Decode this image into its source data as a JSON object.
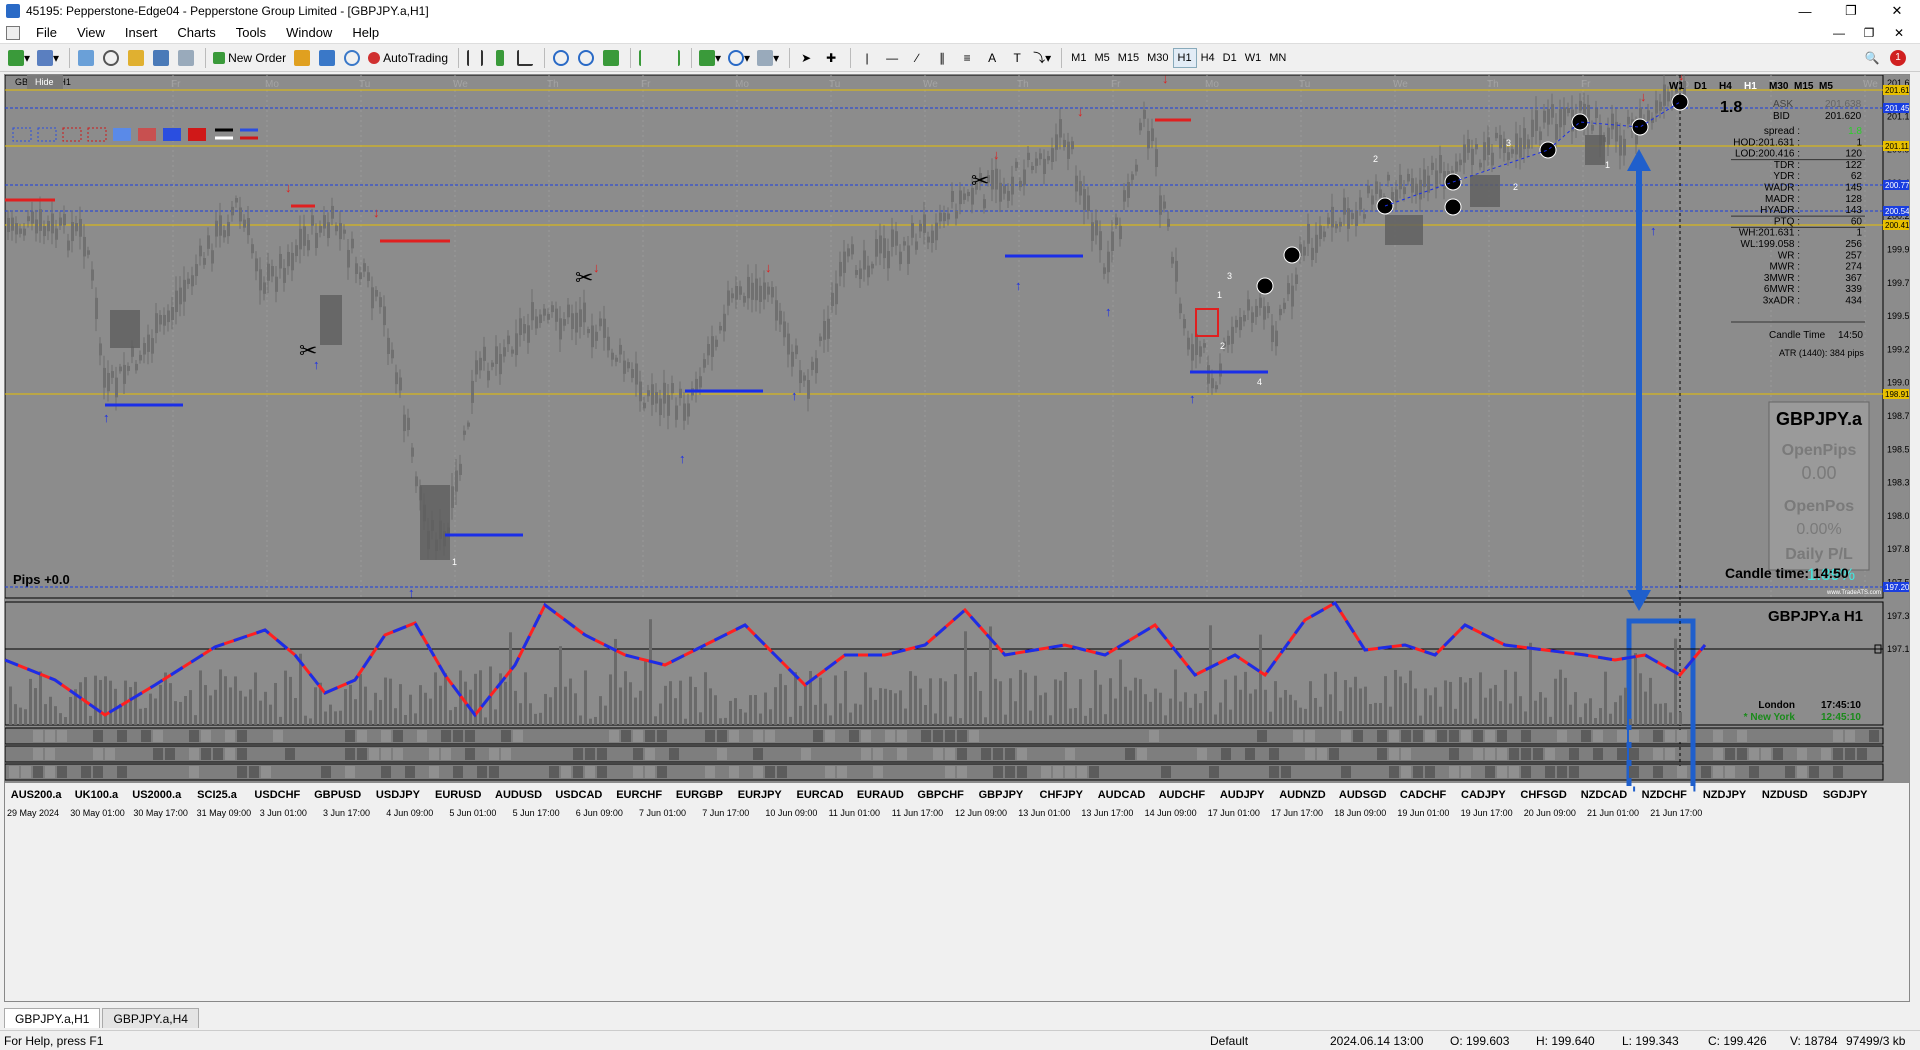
{
  "window": {
    "title": "45195: Pepperstone-Edge04 - Pepperstone Group Limited - [GBPJPY.a,H1]"
  },
  "menu": [
    "File",
    "View",
    "Insert",
    "Charts",
    "Tools",
    "Window",
    "Help"
  ],
  "toolbar": {
    "new_order": "New Order",
    "autotrading": "AutoTrading",
    "timeframes": [
      "M1",
      "M5",
      "M15",
      "M30",
      "H1",
      "H4",
      "D1",
      "W1",
      "MN"
    ],
    "active_timeframe": "H1"
  },
  "chart": {
    "symbol_label": "GBPJPY.a,H1",
    "hide_label": "Hide",
    "day_labels": [
      "Fr",
      "Mo",
      "Tu",
      "We",
      "Th",
      "Fr",
      "Mo",
      "Tu",
      "We",
      "Th",
      "Fr",
      "Mo",
      "Tu",
      "We",
      "Th",
      "Fr",
      "Mo",
      "Tu",
      "We",
      "Th",
      "Fr"
    ],
    "tf_panel": [
      "W1",
      "D1",
      "H4",
      "H1",
      "M30",
      "M15",
      "M5"
    ],
    "active_tf": "H1",
    "price_scale": [
      "201.638",
      "201.180",
      "200.944",
      "200.485",
      "200.222",
      "199.980",
      "199.745",
      "199.505",
      "199.265",
      "199.025",
      "198.785",
      "198.545",
      "198.305",
      "198.065",
      "197.825",
      "197.585",
      "197.345",
      "197.105"
    ],
    "price_tags": [
      {
        "v": "201.613",
        "c": "#e8c000"
      },
      {
        "v": "201.451",
        "c": "#1a3ee0"
      },
      {
        "v": "201.113",
        "c": "#e8c000"
      },
      {
        "v": "200.775",
        "c": "#1a3ee0"
      },
      {
        "v": "200.545",
        "c": "#1a3ee0"
      },
      {
        "v": "200.416",
        "c": "#e8c000"
      },
      {
        "v": "198.919",
        "c": "#e8c000"
      },
      {
        "v": "197.201",
        "c": "#1a3ee0"
      }
    ],
    "info": {
      "spread_big": "1.8",
      "ask_label": "ASK",
      "ask": "201.638",
      "bid_label": "BID",
      "bid": "201.620",
      "rows": [
        [
          "spread :",
          "1.8"
        ],
        [
          "HOD:201.631 :",
          "1"
        ],
        [
          "LOD:200.416 :",
          "120"
        ],
        [
          "TDR :",
          "122"
        ],
        [
          "YDR :",
          "62"
        ],
        [
          "WADR :",
          "145"
        ],
        [
          "MADR :",
          "128"
        ],
        [
          "HYADR :",
          "143"
        ],
        [
          "PTQ :",
          "60"
        ],
        [
          "WH:201.631 :",
          "1"
        ],
        [
          "WL:199.058 :",
          "256"
        ],
        [
          "WR :",
          "257"
        ],
        [
          "MWR :",
          "274"
        ],
        [
          "3MWR :",
          "367"
        ],
        [
          "6MWR :",
          "339"
        ],
        [
          "3xADR :",
          "434"
        ]
      ],
      "candle_time_label": "Candle Time",
      "candle_time": "14:50",
      "atr": "ATR (1440): 384 pips"
    },
    "panel": {
      "symbol": "GBPJPY.a",
      "open_pips_label": "OpenPips",
      "open_pips": "0.00",
      "open_pos_label": "OpenPos",
      "open_pos": "0.00%",
      "daily_label": "Daily P/L",
      "daily": "1.89%",
      "site": "www.TradeATS.com"
    },
    "pips_label": "Pips +0.0",
    "candle_time_big": "Candle time:  14:50",
    "zone_numbers": [
      "1",
      "2",
      "3",
      "4",
      "1",
      "2",
      "3",
      "1",
      "2"
    ],
    "osc_title": "GBPJPY.a  H1",
    "london_label": "London",
    "london_time": "17:45:10",
    "ny_label": "* New York",
    "ny_time": "12:45:10",
    "pairs": [
      "AUS200.a",
      "UK100.a",
      "US2000.a",
      "SCI25.a",
      "USDCHF",
      "GBPUSD",
      "USDJPY",
      "EURUSD",
      "AUDUSD",
      "USDCAD",
      "EURCHF",
      "EURGBP",
      "EURJPY",
      "EURCAD",
      "EURAUD",
      "GBPCHF",
      "GBPJPY",
      "CHFJPY",
      "AUDCAD",
      "AUDCHF",
      "AUDJPY",
      "AUDNZD",
      "AUDSGD",
      "CADCHF",
      "CADJPY",
      "CHFSGD",
      "NZDCAD",
      "NZDCHF",
      "NZDJPY",
      "NZDUSD",
      "SGDJPY"
    ],
    "time_labels": [
      "29 May 2024",
      "30 May 01:00",
      "30 May 17:00",
      "31 May 09:00",
      "3 Jun 01:00",
      "3 Jun 17:00",
      "4 Jun 09:00",
      "5 Jun 01:00",
      "5 Jun 17:00",
      "6 Jun 09:00",
      "7 Jun 01:00",
      "7 Jun 17:00",
      "10 Jun 09:00",
      "11 Jun 01:00",
      "11 Jun 17:00",
      "12 Jun 09:00",
      "13 Jun 01:00",
      "13 Jun 17:00",
      "14 Jun 09:00",
      "17 Jun 01:00",
      "17 Jun 17:00",
      "18 Jun 09:00",
      "19 Jun 01:00",
      "19 Jun 17:00",
      "20 Jun 09:00",
      "21 Jun 01:00",
      "21 Jun 17:00"
    ],
    "colors": {
      "bg": "#8c8c8c",
      "osc_red": "#ff2020",
      "osc_blue": "#1a2ee8",
      "annot_blue": "#1f5fcc"
    }
  },
  "tabs": [
    "GBPJPY.a,H1",
    "GBPJPY.a,H4"
  ],
  "status": {
    "help": "For Help, press F1",
    "profile": "Default",
    "datetime": "2024.06.14 13:00",
    "open": "O: 199.603",
    "high": "H: 199.640",
    "low": "L: 199.343",
    "close": "C: 199.426",
    "volume": "V: 18784",
    "traffic": "97499/3 kb"
  }
}
